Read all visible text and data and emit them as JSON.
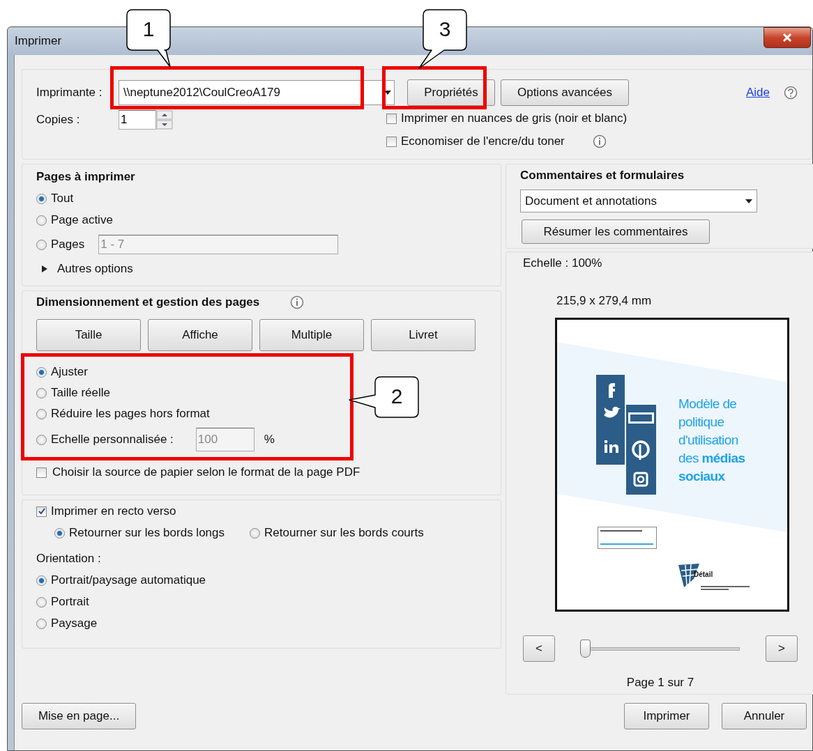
{
  "window": {
    "title": "Imprimer"
  },
  "printer": {
    "label": "Imprimante :",
    "value": "\\\\neptune2012\\CoulCreoA179"
  },
  "copies": {
    "label": "Copies :",
    "value": "1"
  },
  "top_buttons": [
    "Propriétés",
    "Options avancées"
  ],
  "help": "Aide",
  "print_options": [
    {
      "label": "Imprimer en nuances de gris (noir et blanc)",
      "checked": false,
      "info": false
    },
    {
      "label": "Economiser de l'encre/du toner",
      "checked": false,
      "info": true
    }
  ],
  "pages": {
    "title": "Pages à imprimer",
    "choices": [
      {
        "label": "Tout",
        "selected": true
      },
      {
        "label": "Page active",
        "selected": false
      },
      {
        "label": "Pages",
        "selected": false,
        "range": "1 - 7",
        "disabled": true
      }
    ],
    "more": "Autres options"
  },
  "sizing": {
    "title": "Dimensionnement et gestion des pages",
    "modes": [
      "Taille",
      "Affiche",
      "Multiple",
      "Livret"
    ],
    "choices": [
      {
        "label": "Ajuster",
        "selected": true
      },
      {
        "label": "Taille réelle",
        "selected": false
      },
      {
        "label": "Réduire les pages hors format",
        "selected": false
      },
      {
        "label": "Echelle personnalisée :",
        "selected": false,
        "value": "100",
        "disabled": true,
        "unit": "%"
      }
    ],
    "paper_source": {
      "label": "Choisir la source de papier selon le format de la page PDF",
      "checked": false
    }
  },
  "duplex": {
    "label": "Imprimer en recto verso",
    "checked": true,
    "choices": [
      {
        "label": "Retourner sur les bords longs",
        "selected": true
      },
      {
        "label": "Retourner sur les bords courts",
        "selected": false
      }
    ],
    "orientation_title": "Orientation :",
    "orientations": [
      {
        "label": "Portrait/paysage automatique",
        "selected": true
      },
      {
        "label": "Portrait",
        "selected": false
      },
      {
        "label": "Paysage",
        "selected": false
      }
    ]
  },
  "comments": {
    "title": "Commentaires et formulaires",
    "select": "Document et annotations",
    "button": "Résumer les commentaires"
  },
  "preview": {
    "scale": "Echelle : 100%",
    "size": "215,9 x 279,4 mm",
    "document_title": "Modèle de politique d'utilisation des **médias sociaux**",
    "logo": "Détail",
    "prev": "<",
    "next": ">",
    "level": 0,
    "page": "Page 1 sur 7"
  },
  "footer": {
    "setup": "Mise en page...",
    "print": "Imprimer",
    "cancel": "Annuler"
  },
  "callouts": [
    "1",
    "3",
    "2"
  ]
}
